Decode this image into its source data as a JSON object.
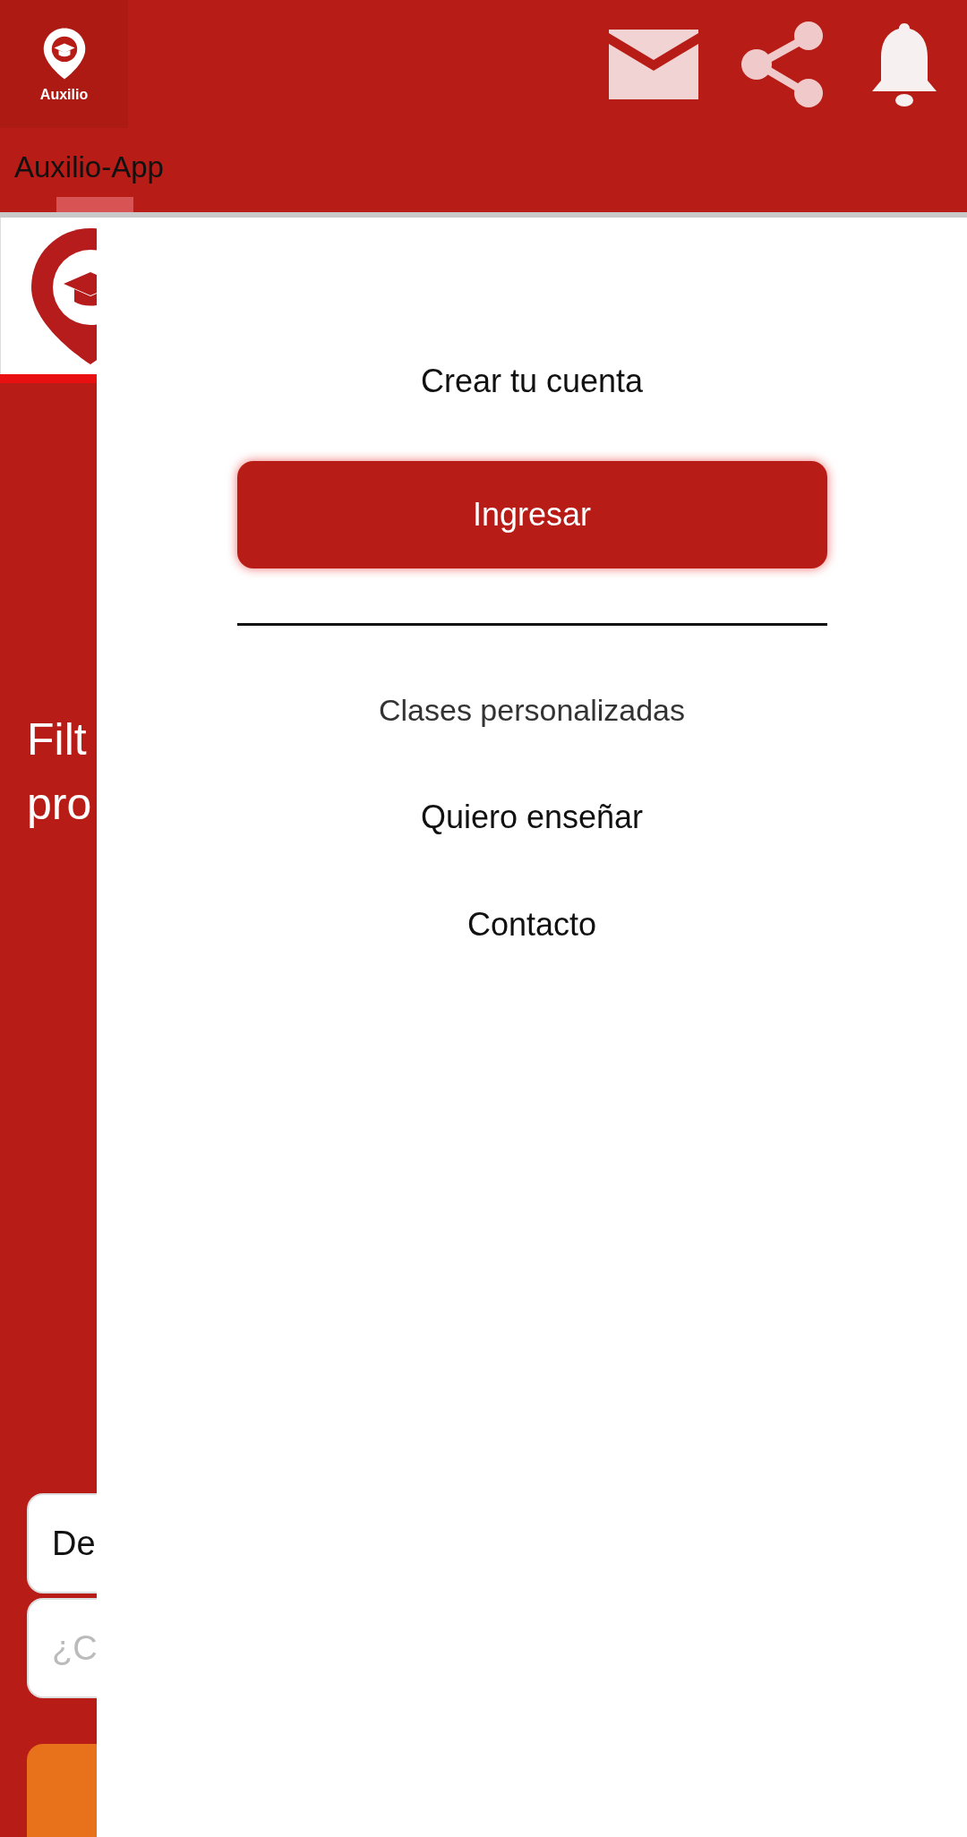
{
  "header": {
    "logo_text": "Auxilio",
    "title": "Auxilio-App"
  },
  "background_page": {
    "heading_lines": [
      "Filt",
      "pro"
    ],
    "fields": [
      {
        "value": "De"
      },
      {
        "placeholder": "¿C"
      }
    ]
  },
  "drawer": {
    "items": [
      {
        "kind": "link",
        "label": "Crear tu cuenta"
      },
      {
        "kind": "button",
        "label": "Ingresar"
      },
      {
        "kind": "divider"
      },
      {
        "kind": "link",
        "label": "Clases personalizadas"
      },
      {
        "kind": "link",
        "label": "Quiero enseñar"
      },
      {
        "kind": "link",
        "label": "Contacto"
      }
    ]
  }
}
